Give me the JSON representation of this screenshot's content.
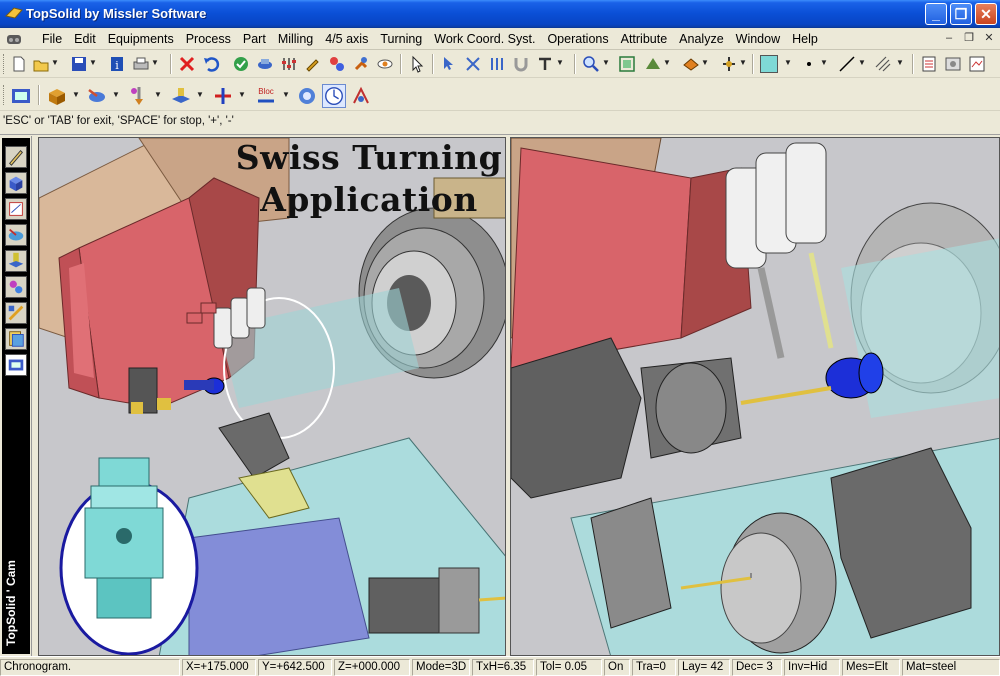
{
  "window": {
    "title": "TopSolid by Missler Software",
    "min_label": "_",
    "max_label": "❐",
    "close_label": "✕"
  },
  "menu": {
    "items": [
      "File",
      "Edit",
      "Equipments",
      "Process",
      "Part",
      "Milling",
      "4/5 axis",
      "Turning",
      "Work Coord. Syst.",
      "Operations",
      "Attribute",
      "Analyze",
      "Window",
      "Help"
    ],
    "mdi_min": "–",
    "mdi_restore": "❐",
    "mdi_close": "✕"
  },
  "prompt": {
    "text": "'ESC' or 'TAB' for exit, 'SPACE' for stop, '+', '-'"
  },
  "sidebar": {
    "label": "TopSolid ' Cam"
  },
  "scene": {
    "title_line1": "Swiss Turning",
    "title_line2": "Application"
  },
  "status": {
    "mode_name": "Chronogram.",
    "x": "X=+175.000",
    "y": "Y=+642.500",
    "z": "Z=+000.000",
    "mode": "Mode=3D",
    "txh": "TxH=6.35",
    "tol": "Tol=  0.05",
    "on": "On",
    "tra": "Tra=0",
    "lay": "Lay= 42",
    "dec": "Dec= 3",
    "inv": "Inv=Hid",
    "mes": "Mes=Elt",
    "mat": "Mat=steel"
  },
  "colors": {
    "title_bar": "#0a4fd6",
    "chrome": "#ece9d8",
    "viewport_bg": "#c7c7cb",
    "turret_red": "#d8646a",
    "part_cyan": "#7fd9d6",
    "tool_blue": "#1c2fd8",
    "gray_steel": "#8e8e8e"
  }
}
